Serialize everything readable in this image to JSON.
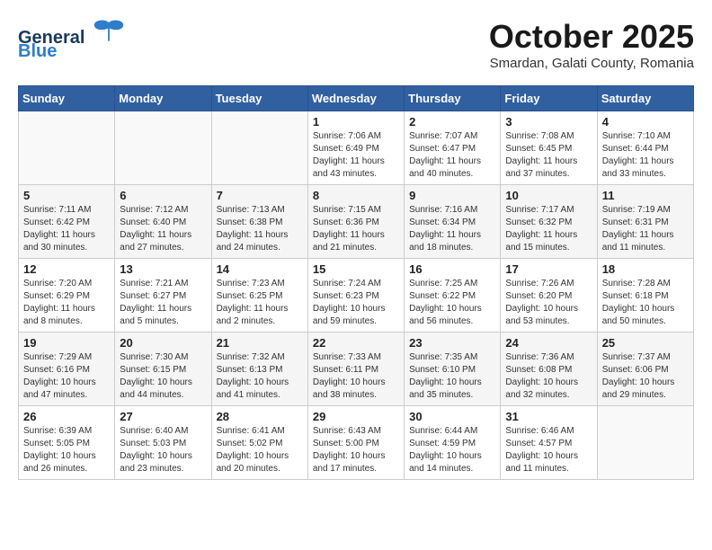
{
  "header": {
    "logo_general": "General",
    "logo_blue": "Blue",
    "month_title": "October 2025",
    "location": "Smardan, Galati County, Romania"
  },
  "weekdays": [
    "Sunday",
    "Monday",
    "Tuesday",
    "Wednesday",
    "Thursday",
    "Friday",
    "Saturday"
  ],
  "weeks": [
    [
      {
        "day": "",
        "info": ""
      },
      {
        "day": "",
        "info": ""
      },
      {
        "day": "",
        "info": ""
      },
      {
        "day": "1",
        "info": "Sunrise: 7:06 AM\nSunset: 6:49 PM\nDaylight: 11 hours\nand 43 minutes."
      },
      {
        "day": "2",
        "info": "Sunrise: 7:07 AM\nSunset: 6:47 PM\nDaylight: 11 hours\nand 40 minutes."
      },
      {
        "day": "3",
        "info": "Sunrise: 7:08 AM\nSunset: 6:45 PM\nDaylight: 11 hours\nand 37 minutes."
      },
      {
        "day": "4",
        "info": "Sunrise: 7:10 AM\nSunset: 6:44 PM\nDaylight: 11 hours\nand 33 minutes."
      }
    ],
    [
      {
        "day": "5",
        "info": "Sunrise: 7:11 AM\nSunset: 6:42 PM\nDaylight: 11 hours\nand 30 minutes."
      },
      {
        "day": "6",
        "info": "Sunrise: 7:12 AM\nSunset: 6:40 PM\nDaylight: 11 hours\nand 27 minutes."
      },
      {
        "day": "7",
        "info": "Sunrise: 7:13 AM\nSunset: 6:38 PM\nDaylight: 11 hours\nand 24 minutes."
      },
      {
        "day": "8",
        "info": "Sunrise: 7:15 AM\nSunset: 6:36 PM\nDaylight: 11 hours\nand 21 minutes."
      },
      {
        "day": "9",
        "info": "Sunrise: 7:16 AM\nSunset: 6:34 PM\nDaylight: 11 hours\nand 18 minutes."
      },
      {
        "day": "10",
        "info": "Sunrise: 7:17 AM\nSunset: 6:32 PM\nDaylight: 11 hours\nand 15 minutes."
      },
      {
        "day": "11",
        "info": "Sunrise: 7:19 AM\nSunset: 6:31 PM\nDaylight: 11 hours\nand 11 minutes."
      }
    ],
    [
      {
        "day": "12",
        "info": "Sunrise: 7:20 AM\nSunset: 6:29 PM\nDaylight: 11 hours\nand 8 minutes."
      },
      {
        "day": "13",
        "info": "Sunrise: 7:21 AM\nSunset: 6:27 PM\nDaylight: 11 hours\nand 5 minutes."
      },
      {
        "day": "14",
        "info": "Sunrise: 7:23 AM\nSunset: 6:25 PM\nDaylight: 11 hours\nand 2 minutes."
      },
      {
        "day": "15",
        "info": "Sunrise: 7:24 AM\nSunset: 6:23 PM\nDaylight: 10 hours\nand 59 minutes."
      },
      {
        "day": "16",
        "info": "Sunrise: 7:25 AM\nSunset: 6:22 PM\nDaylight: 10 hours\nand 56 minutes."
      },
      {
        "day": "17",
        "info": "Sunrise: 7:26 AM\nSunset: 6:20 PM\nDaylight: 10 hours\nand 53 minutes."
      },
      {
        "day": "18",
        "info": "Sunrise: 7:28 AM\nSunset: 6:18 PM\nDaylight: 10 hours\nand 50 minutes."
      }
    ],
    [
      {
        "day": "19",
        "info": "Sunrise: 7:29 AM\nSunset: 6:16 PM\nDaylight: 10 hours\nand 47 minutes."
      },
      {
        "day": "20",
        "info": "Sunrise: 7:30 AM\nSunset: 6:15 PM\nDaylight: 10 hours\nand 44 minutes."
      },
      {
        "day": "21",
        "info": "Sunrise: 7:32 AM\nSunset: 6:13 PM\nDaylight: 10 hours\nand 41 minutes."
      },
      {
        "day": "22",
        "info": "Sunrise: 7:33 AM\nSunset: 6:11 PM\nDaylight: 10 hours\nand 38 minutes."
      },
      {
        "day": "23",
        "info": "Sunrise: 7:35 AM\nSunset: 6:10 PM\nDaylight: 10 hours\nand 35 minutes."
      },
      {
        "day": "24",
        "info": "Sunrise: 7:36 AM\nSunset: 6:08 PM\nDaylight: 10 hours\nand 32 minutes."
      },
      {
        "day": "25",
        "info": "Sunrise: 7:37 AM\nSunset: 6:06 PM\nDaylight: 10 hours\nand 29 minutes."
      }
    ],
    [
      {
        "day": "26",
        "info": "Sunrise: 6:39 AM\nSunset: 5:05 PM\nDaylight: 10 hours\nand 26 minutes."
      },
      {
        "day": "27",
        "info": "Sunrise: 6:40 AM\nSunset: 5:03 PM\nDaylight: 10 hours\nand 23 minutes."
      },
      {
        "day": "28",
        "info": "Sunrise: 6:41 AM\nSunset: 5:02 PM\nDaylight: 10 hours\nand 20 minutes."
      },
      {
        "day": "29",
        "info": "Sunrise: 6:43 AM\nSunset: 5:00 PM\nDaylight: 10 hours\nand 17 minutes."
      },
      {
        "day": "30",
        "info": "Sunrise: 6:44 AM\nSunset: 4:59 PM\nDaylight: 10 hours\nand 14 minutes."
      },
      {
        "day": "31",
        "info": "Sunrise: 6:46 AM\nSunset: 4:57 PM\nDaylight: 10 hours\nand 11 minutes."
      },
      {
        "day": "",
        "info": ""
      }
    ]
  ]
}
